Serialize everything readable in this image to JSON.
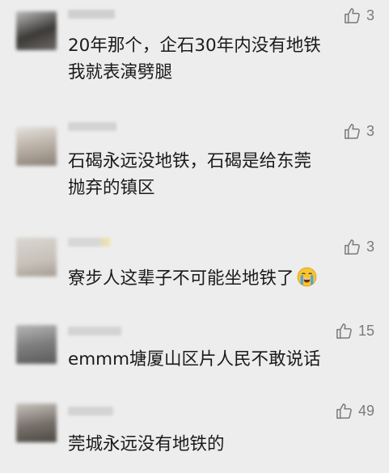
{
  "comments": [
    {
      "likes": "3",
      "lines": [
        "20年那个，企石30年内没有地铁",
        "我就表演劈腿"
      ]
    },
    {
      "likes": "3",
      "lines": [
        "石碣永远没地铁，石碣是给东莞",
        "抛弃的镇区"
      ]
    },
    {
      "likes": "3",
      "lines": [
        "寮步人这辈子不可能坐地铁了"
      ],
      "emoji": "crying-face"
    },
    {
      "likes": "15",
      "lines": [
        "emmm塘厦山区片人民不敢说话"
      ]
    },
    {
      "likes": "49",
      "lines": [
        "莞城永远没有地铁的"
      ]
    }
  ],
  "colors": {
    "background": "#ededed",
    "text": "#1a1a1a",
    "like": "#7b7b7b"
  }
}
